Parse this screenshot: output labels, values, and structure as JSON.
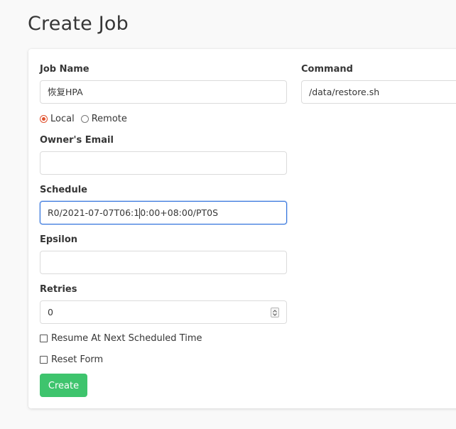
{
  "page": {
    "title": "Create Job"
  },
  "form": {
    "job_name": {
      "label": "Job Name",
      "value": "恢复HPA"
    },
    "location": {
      "options": [
        "Local",
        "Remote"
      ],
      "selected": "Local"
    },
    "owner_email": {
      "label": "Owner's Email",
      "value": ""
    },
    "schedule": {
      "label": "Schedule",
      "value_before_caret": "R0/2021-07-07T06:1",
      "value_after_caret": "0:00+08:00/PT0S"
    },
    "epsilon": {
      "label": "Epsilon",
      "value": ""
    },
    "retries": {
      "label": "Retries",
      "value": "0"
    },
    "resume_at_next": {
      "label": "Resume At Next Scheduled Time",
      "checked": false
    },
    "reset_form": {
      "label": "Reset Form",
      "checked": false
    },
    "command": {
      "label": "Command",
      "value": "/data/restore.sh"
    },
    "submit_label": "Create"
  },
  "colors": {
    "accent_radio": "#e0522f",
    "focus_border": "#3273dc",
    "submit_button": "#3ec46d"
  }
}
